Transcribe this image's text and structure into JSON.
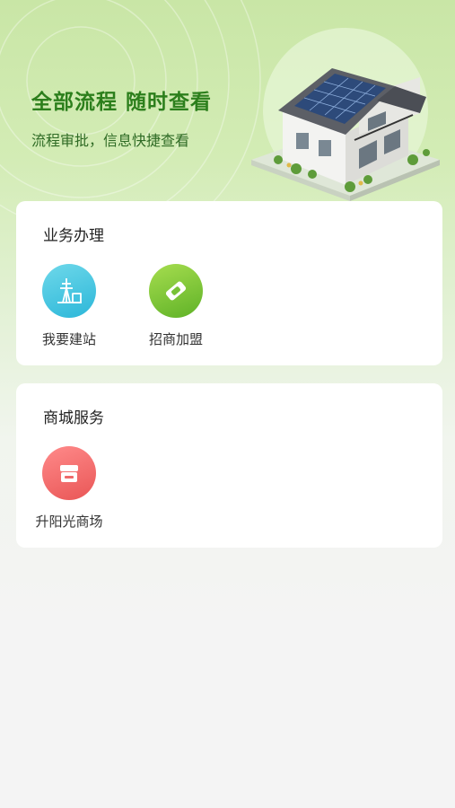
{
  "hero": {
    "title": "全部流程  随时查看",
    "subtitle": "流程审批，信息快捷查看",
    "image_icon": "solar-house-illustration"
  },
  "business": {
    "title": "业务办理",
    "items": [
      {
        "label": "我要建站",
        "icon": "power-tower-icon",
        "color": "#2cb7d9"
      },
      {
        "label": "招商加盟",
        "icon": "handshake-icon",
        "color": "#5fb227"
      }
    ]
  },
  "mall": {
    "title": "商城服务",
    "items": [
      {
        "label": "升阳光商场",
        "icon": "store-icon",
        "color": "#e95656"
      }
    ]
  },
  "colors": {
    "accent_green": "#2c7f1c",
    "background": "#f4f4f4",
    "card": "#ffffff"
  }
}
